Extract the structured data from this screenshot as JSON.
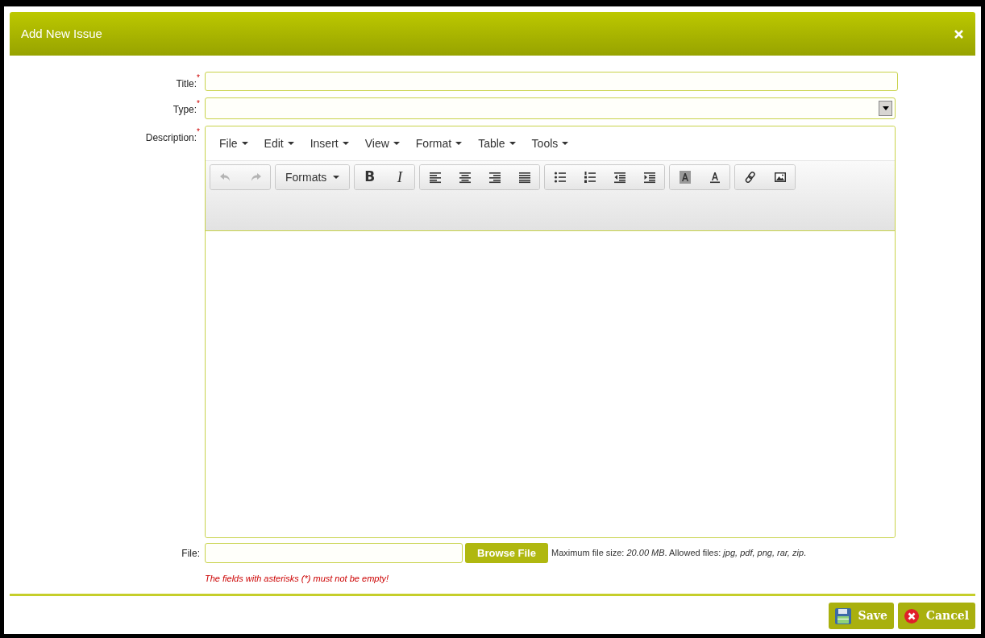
{
  "dialog": {
    "title": "Add New Issue"
  },
  "fields": [
    {
      "label": "Title:",
      "mark": "*",
      "kind": "text"
    },
    {
      "label": "Type:",
      "mark": "*",
      "kind": "select"
    }
  ],
  "description": {
    "label": "Description:",
    "mark": "*",
    "menu": [
      "File",
      "Edit",
      "Insert",
      "View",
      "Format",
      "Table",
      "Tools"
    ],
    "toolbar": [
      [
        {
          "kind": "undo",
          "disabled": true
        },
        {
          "kind": "redo",
          "disabled": true
        }
      ],
      [
        {
          "kind": "dropdown",
          "label": "Formats"
        }
      ],
      [
        {
          "kind": "bold",
          "label": "B"
        },
        {
          "kind": "italic",
          "label": "I"
        }
      ],
      [
        {
          "kind": "align-left"
        },
        {
          "kind": "align-center"
        },
        {
          "kind": "align-right"
        },
        {
          "kind": "justify"
        }
      ],
      [
        {
          "kind": "bullet-list"
        },
        {
          "kind": "numbered-list"
        },
        {
          "kind": "outdent"
        },
        {
          "kind": "indent"
        }
      ],
      [
        {
          "kind": "background-color"
        },
        {
          "kind": "text-color"
        }
      ],
      [
        {
          "kind": "link"
        },
        {
          "kind": "image"
        }
      ]
    ]
  },
  "file": {
    "label": "File:",
    "button": "Browse File",
    "note": "Maximum file size: *20.00 MB*. Allowed files: *jpg, pdf, png, rar, zip*."
  },
  "error": "The fields with asterisks (*) must not be empty!",
  "buttons": [
    {
      "kind": "save",
      "label": "Save"
    },
    {
      "kind": "cancel",
      "label": "Cancel"
    }
  ]
}
